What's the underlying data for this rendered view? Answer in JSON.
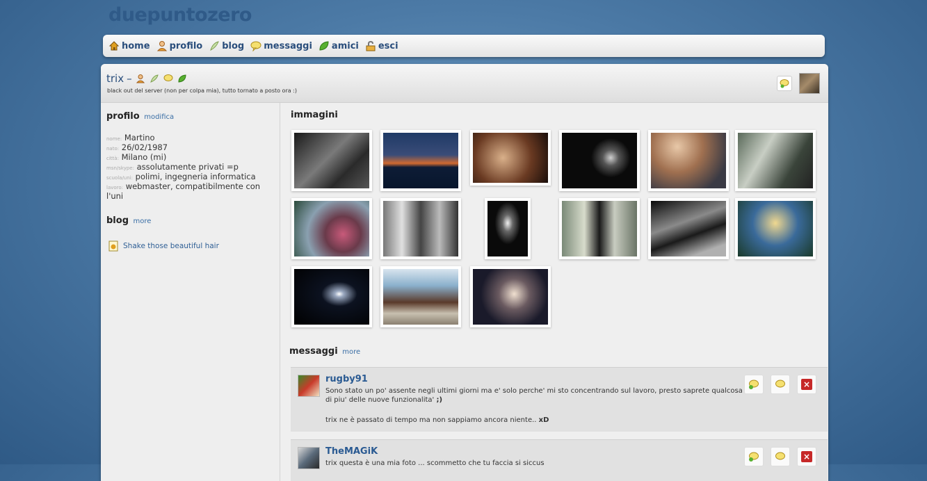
{
  "app": {
    "brand": "duepuntozero"
  },
  "nav": {
    "items": [
      {
        "label": "home",
        "icon": "home-icon"
      },
      {
        "label": "profilo",
        "icon": "user-icon"
      },
      {
        "label": "blog",
        "icon": "feather-icon"
      },
      {
        "label": "messaggi",
        "icon": "speech-bubble-icon"
      },
      {
        "label": "amici",
        "icon": "leaf-icon"
      },
      {
        "label": "esci",
        "icon": "exit-icon"
      }
    ]
  },
  "user": {
    "name": "trix",
    "separator": "–",
    "status": "black out del server (non per colpa mia), tutto tornato a posto ora :)"
  },
  "profile": {
    "title": "profilo",
    "edit_link": "modifica",
    "fields": [
      {
        "key": "nome:",
        "value": "Martino"
      },
      {
        "key": "nato:",
        "value": "26/02/1987"
      },
      {
        "key": "città:",
        "value": "Milano (mi)"
      },
      {
        "key": "msn/skype:",
        "value": "assolutamente privati =p"
      },
      {
        "key": "scuola/uni:",
        "value": "polimi, ingegneria informatica"
      },
      {
        "key": "lavoro:",
        "value": "webmaster, compatibilmente con l'uni"
      }
    ]
  },
  "blog": {
    "title": "blog",
    "more": "more",
    "posts": [
      "Shake those beautiful hair"
    ]
  },
  "images": {
    "title": "immagini",
    "count": 15
  },
  "messages": {
    "title": "messaggi",
    "more": "more",
    "items": [
      {
        "user": "rugby91",
        "text": "Sono stato un po' assente negli ultimi giorni ma e' solo perche' mi sto concentrando sul lavoro, presto saprete qualcosa di piu' delle nuove funzionalita'",
        "emote": ";)",
        "reply": "trix ne è passato di tempo ma non sappiamo ancora niente..",
        "reply_emote": "xD"
      },
      {
        "user": "TheMAGiK",
        "text": "trix questa è una mia foto ... scommetto che tu faccia si siccus"
      }
    ]
  },
  "colors": {
    "accent": "#2a4e7c",
    "link": "#3a6ea5",
    "delete": "#c62828"
  }
}
